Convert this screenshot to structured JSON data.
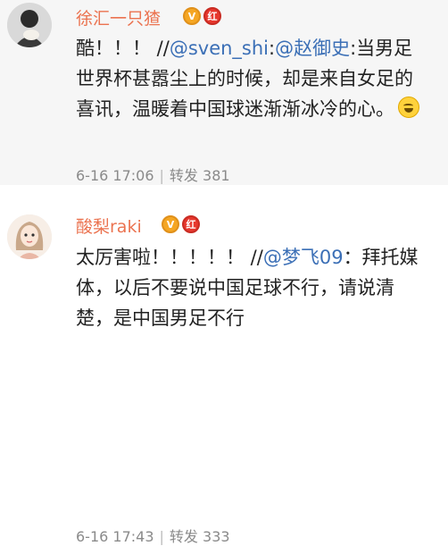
{
  "comments": [
    {
      "username": "徐汇一只猹",
      "badge_vip": "V",
      "badge_red": "红",
      "text_prefix": "酷！！！ //",
      "mention1": "@sven_shi",
      "text_mid": ":",
      "mention2": "@赵御史",
      "text_rest": ":当男足世界杯甚嚣尘上的时候，却是来自女足的喜讯，温暖着中国球迷渐渐冰冷的心。",
      "emoji": "laugh-cry-emoji",
      "date": "6-16 17:06",
      "repost_label": "转发",
      "repost_count": "381"
    },
    {
      "username": "酸梨raki",
      "badge_vip": "V",
      "badge_red": "红",
      "text_prefix": "太厉害啦！！！！！ //",
      "mention1": "@梦飞09",
      "text_rest": "：拜托媒体，以后不要说中国足球不行，请说清楚，是中国男足不行",
      "date": "6-16 17:43",
      "repost_label": "转发",
      "repost_count": "333"
    }
  ]
}
